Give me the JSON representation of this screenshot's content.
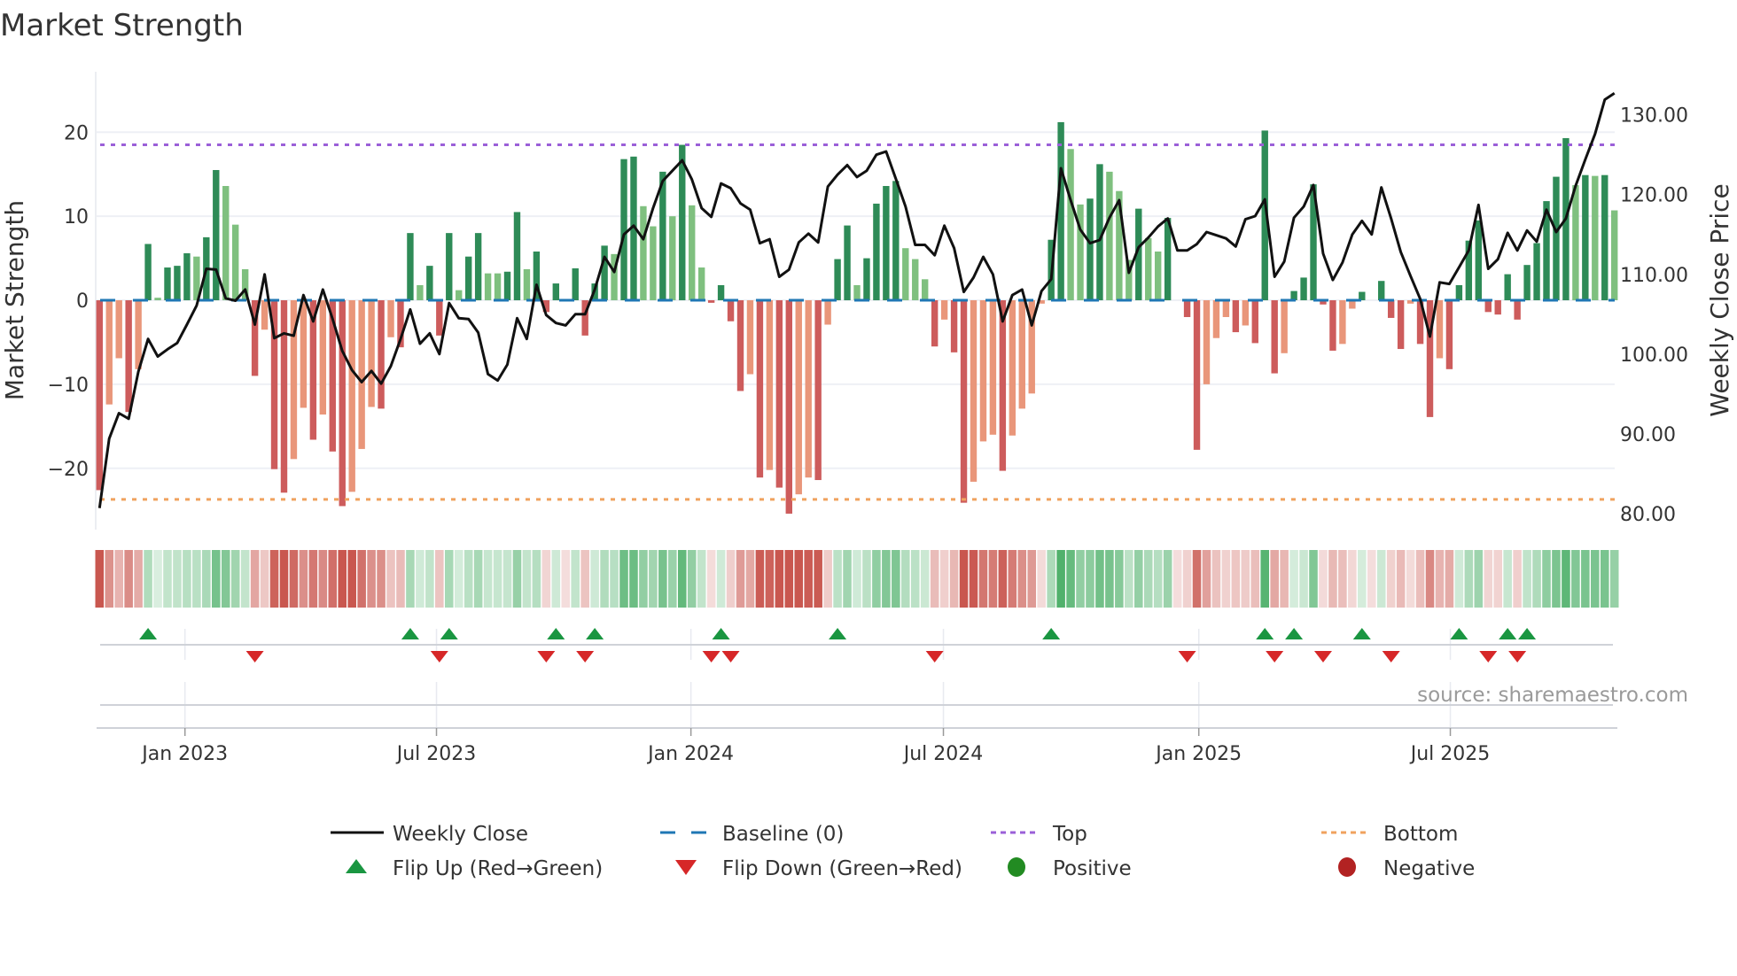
{
  "title": "Market Strength",
  "source_note": "source: sharemaestro.com",
  "colors": {
    "strong_positive": "#2e8b57",
    "weak_positive": "#7fc07f",
    "strong_negative": "#cd5c5c",
    "weak_negative": "#e9967a",
    "baseline": "#1f77b4",
    "top": "#9b5fd8",
    "bottom": "#f0a25e",
    "price_line": "#111111",
    "flip_up": "#1a9641",
    "flip_down": "#d62728",
    "positive_dot": "#228b22",
    "negative_dot": "#b22222",
    "strip_green": "#4caf68",
    "strip_red": "#c9574f"
  },
  "legend": [
    {
      "label": "Weekly Close",
      "kind": "line"
    },
    {
      "label": "Baseline (0)",
      "kind": "dash"
    },
    {
      "label": "Top",
      "kind": "dot-purple"
    },
    {
      "label": "Bottom",
      "kind": "dot-orange"
    },
    {
      "label": "Flip Up (Red→Green)",
      "kind": "tri-up"
    },
    {
      "label": "Flip Down (Green→Red)",
      "kind": "tri-down"
    },
    {
      "label": "Positive",
      "kind": "circle-green"
    },
    {
      "label": "Negative",
      "kind": "circle-red"
    }
  ],
  "chart_data": {
    "type": "bar",
    "title": "Market Strength",
    "ylabel": "Market Strength",
    "y2label": "Weekly Close Price",
    "ylim": [
      -27.3,
      27.2
    ],
    "y2lim": [
      78.0,
      135.4
    ],
    "xlim": [
      0.7,
      157.3
    ],
    "grid": true,
    "legend_position": "bottom",
    "yticks": [
      {
        "v": 20,
        "label": "20"
      },
      {
        "v": 10,
        "label": "10"
      },
      {
        "v": 0,
        "label": "0"
      },
      {
        "v": -10,
        "label": "−10"
      },
      {
        "v": -20,
        "label": "−20"
      }
    ],
    "y2ticks": [
      {
        "v": 130,
        "label": "130.00"
      },
      {
        "v": 120,
        "label": "120.00"
      },
      {
        "v": 110,
        "label": "110.00"
      },
      {
        "v": 100,
        "label": "100.00"
      },
      {
        "v": 90,
        "label": "90.00"
      },
      {
        "v": 80,
        "label": "80.00"
      }
    ],
    "xticks": [
      {
        "week": 9.8,
        "label": "Jan 2023"
      },
      {
        "week": 35.7,
        "label": "Jul 2023"
      },
      {
        "week": 61.9,
        "label": "Jan 2024"
      },
      {
        "week": 87.9,
        "label": "Jul 2024"
      },
      {
        "week": 114.2,
        "label": "Jan 2025"
      },
      {
        "week": 140.1,
        "label": "Jul 2025"
      }
    ],
    "top_level": 18.5,
    "bottom_level": -23.7,
    "baseline": 0,
    "strength": [
      -22.6,
      -12.4,
      -6.9,
      -13.3,
      -8.2,
      6.7,
      0.3,
      3.9,
      4.1,
      5.6,
      5.2,
      7.5,
      15.5,
      13.6,
      9.0,
      3.7,
      -9.0,
      -3.5,
      -20.1,
      -22.9,
      -18.9,
      -12.8,
      -16.6,
      -13.6,
      -18.0,
      -24.5,
      -22.8,
      -17.7,
      -12.7,
      -12.9,
      -4.4,
      -5.6,
      8.0,
      1.8,
      4.1,
      -4.2,
      8.0,
      1.2,
      5.2,
      8.0,
      3.2,
      3.2,
      3.4,
      10.5,
      3.7,
      5.8,
      -1.4,
      2.0,
      0,
      3.8,
      -4.2,
      2.0,
      6.5,
      5.5,
      16.8,
      17.1,
      11.2,
      8.8,
      15.3,
      10.0,
      18.5,
      11.3,
      3.9,
      -0.3,
      1.8,
      -2.5,
      -10.8,
      -8.8,
      -21.1,
      -20.2,
      -22.3,
      -25.4,
      -23.1,
      -21.1,
      -21.4,
      -2.9,
      4.9,
      8.9,
      1.8,
      5.0,
      11.5,
      13.6,
      14.2,
      6.2,
      4.9,
      2.5,
      -5.5,
      -2.3,
      -6.2,
      -24.1,
      -21.6,
      -16.8,
      -16.0,
      -20.3,
      -16.1,
      -12.9,
      -11.1,
      -0.4,
      7.2,
      21.2,
      18.0,
      11.4,
      12.1,
      16.2,
      15.3,
      13.0,
      4.8,
      10.9,
      7.4,
      5.8,
      9.8,
      0,
      -2.0,
      -17.8,
      -10.0,
      -4.5,
      -2.0,
      -3.8,
      -3.0,
      -5.1,
      20.2,
      -8.7,
      -6.3,
      1.1,
      2.7,
      13.8,
      -0.5,
      -6.0,
      -5.2,
      -1.0,
      1.0,
      0,
      2.3,
      -2.1,
      -5.8,
      -0.4,
      -5.2,
      -13.9,
      -6.9,
      -8.2,
      1.8,
      7.1,
      9.5,
      -1.4,
      -1.7,
      3.1,
      -2.3,
      4.2,
      6.8,
      11.8,
      14.7,
      19.3,
      13.7,
      14.9,
      14.8,
      14.9,
      10.7
    ],
    "strong": [
      1,
      0,
      0,
      1,
      0,
      1,
      0,
      1,
      1,
      1,
      0,
      1,
      1,
      0,
      0,
      0,
      1,
      0,
      1,
      1,
      0,
      0,
      1,
      0,
      1,
      1,
      0,
      0,
      0,
      1,
      0,
      1,
      1,
      0,
      1,
      1,
      1,
      0,
      1,
      1,
      0,
      0,
      1,
      1,
      0,
      1,
      1,
      1,
      1,
      1,
      1,
      1,
      1,
      0,
      1,
      1,
      0,
      0,
      1,
      0,
      1,
      0,
      0,
      1,
      1,
      1,
      1,
      0,
      1,
      0,
      1,
      1,
      0,
      0,
      1,
      0,
      1,
      1,
      0,
      1,
      1,
      1,
      1,
      0,
      0,
      0,
      1,
      0,
      1,
      1,
      0,
      0,
      0,
      1,
      0,
      0,
      0,
      0,
      1,
      1,
      0,
      0,
      1,
      1,
      0,
      0,
      0,
      1,
      0,
      0,
      1,
      1,
      1,
      1,
      0,
      0,
      0,
      1,
      0,
      1,
      1,
      1,
      0,
      1,
      1,
      1,
      1,
      1,
      0,
      0,
      1,
      1,
      1,
      1,
      1,
      0,
      1,
      1,
      0,
      1,
      1,
      1,
      1,
      1,
      1,
      1,
      1,
      1,
      1,
      1,
      1,
      1,
      0,
      1,
      0,
      1,
      0
    ],
    "weekly_close": [
      80.7,
      89.4,
      92.6,
      91.9,
      97.8,
      101.9,
      99.7,
      100.6,
      101.4,
      103.7,
      106.1,
      110.7,
      110.6,
      107.0,
      106.7,
      108.1,
      103.7,
      110.0,
      102.0,
      102.6,
      102.3,
      107.4,
      104.1,
      108.1,
      104.4,
      100.4,
      98.0,
      96.5,
      97.9,
      96.3,
      98.5,
      101.9,
      105.6,
      101.3,
      102.6,
      100.0,
      106.4,
      104.5,
      104.4,
      102.7,
      97.5,
      96.7,
      98.7,
      104.5,
      101.9,
      108.7,
      104.9,
      103.9,
      103.6,
      105.0,
      105.0,
      108.1,
      112.2,
      110.3,
      115.0,
      116.1,
      114.4,
      118.3,
      121.7,
      123.0,
      124.3,
      121.9,
      118.3,
      117.2,
      121.4,
      120.8,
      118.9,
      118.1,
      113.9,
      114.4,
      109.7,
      110.6,
      114.0,
      115.1,
      114.0,
      121.0,
      122.5,
      123.7,
      122.2,
      123.0,
      125.0,
      125.4,
      122.0,
      118.5,
      113.7,
      113.7,
      112.4,
      116.1,
      113.3,
      107.8,
      109.6,
      112.2,
      110.0,
      104.1,
      107.4,
      108.1,
      103.6,
      107.9,
      109.4,
      123.3,
      119.3,
      115.6,
      113.9,
      114.3,
      117.1,
      119.3,
      110.2,
      113.4,
      114.6,
      116.0,
      117.0,
      113.0,
      113.0,
      113.8,
      115.3,
      114.9,
      114.5,
      113.5,
      116.9,
      117.3,
      119.4,
      109.7,
      111.6,
      117.1,
      118.5,
      121.2,
      112.6,
      109.3,
      111.5,
      115.0,
      116.7,
      115.0,
      120.9,
      117.0,
      112.8,
      109.8,
      106.9,
      102.2,
      109.0,
      108.8,
      110.9,
      113.0,
      118.7,
      110.7,
      111.9,
      115.2,
      113.0,
      115.5,
      114.1,
      118.1,
      115.3,
      117.0,
      121.1,
      124.4,
      127.6,
      131.9,
      132.7
    ],
    "flip_up_weeks": [
      6,
      33,
      37,
      48,
      52,
      65,
      77,
      99,
      121,
      124,
      131,
      141,
      146,
      148
    ],
    "flip_down_weeks": [
      17,
      36,
      47,
      51,
      64,
      66,
      87,
      113,
      122,
      127,
      134,
      144,
      147
    ]
  }
}
